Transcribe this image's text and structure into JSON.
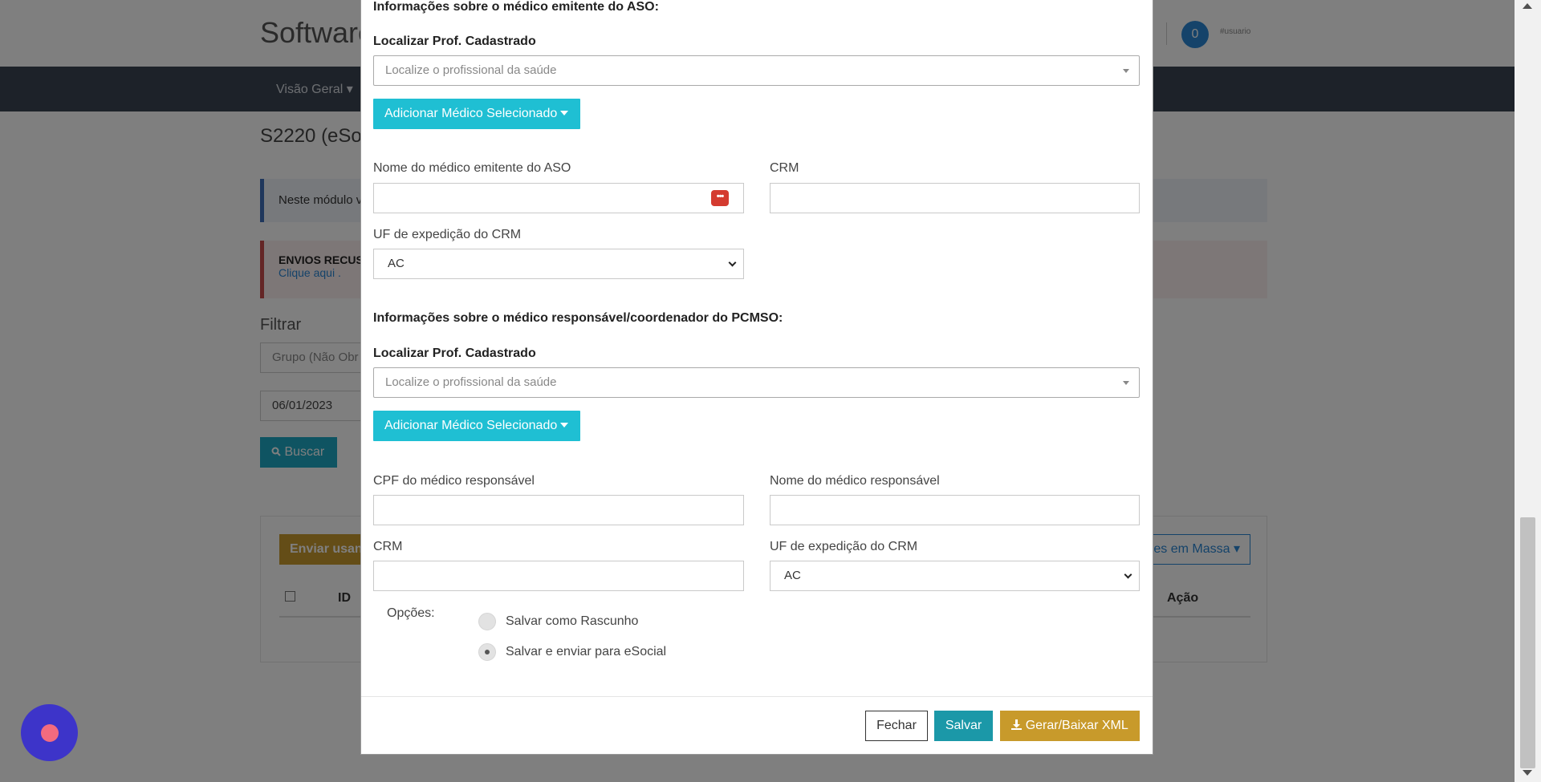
{
  "background": {
    "brand": "Software",
    "notification_count": "0",
    "user_label": "#usuario",
    "nav_item": "Visão Geral ▾",
    "page_heading": "S2220 (eSo",
    "info_alert": "Neste módulo v",
    "danger_title": "ENVIOS RECUS",
    "danger_link": "Clique aqui .",
    "filter_title": "Filtrar",
    "group_placeholder": "Grupo (Não Obr",
    "date_value": "06/01/2023",
    "search_button": "Buscar",
    "send_button": "Enviar usan",
    "bulk_actions_button": "es em Massa ▾",
    "table_headers": {
      "id": "ID",
      "action": "Ação"
    }
  },
  "modal": {
    "aso_section_title": "Informações sobre o médico emitente do ASO:",
    "locate_label": "Localizar Prof. Cadastrado",
    "locate_placeholder": "Localize o profissional da saúde",
    "add_button": "Adicionar Médico Selecionado",
    "aso_doctor_name_label": "Nome do médico emitente do ASO",
    "aso_crm_label": "CRM",
    "aso_uf_label": "UF de expedição do CRM",
    "aso_uf_value": "AC",
    "pcmso_section_title": "Informações sobre o médico responsável/coordenador do PCMSO:",
    "locate_label_2": "Localizar Prof. Cadastrado",
    "locate_placeholder_2": "Localize o profissional da saúde",
    "add_button_2": "Adicionar Médico Selecionado",
    "resp_cpf_label": "CPF do médico responsável",
    "resp_name_label": "Nome do médico responsável",
    "resp_crm_label": "CRM",
    "resp_uf_label": "UF de expedição do CRM",
    "resp_uf_value": "AC",
    "options_label": "Opções:",
    "option_draft": "Salvar como Rascunho",
    "option_send": "Salvar e enviar para eSocial",
    "close_button": "Fechar",
    "save_button": "Salvar",
    "xml_button": "Gerar/Baixar XML"
  },
  "colors": {
    "modal_add_button": "#1fbfd3",
    "save_button": "#1b98a8",
    "xml_button": "#c89a2b",
    "navbar": "#3b4452"
  }
}
